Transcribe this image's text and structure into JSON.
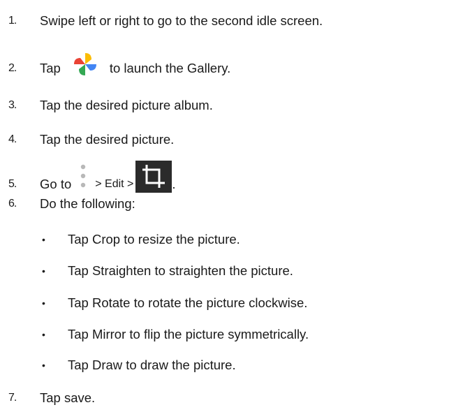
{
  "steps": [
    {
      "num": "1.",
      "text": "Swipe left or right to go to the second idle screen."
    },
    {
      "num": "2.",
      "before": "Tap",
      "icon": "gallery-pinwheel-icon",
      "after": "to launch the Gallery."
    },
    {
      "num": "3.",
      "text": "Tap the desired picture album."
    },
    {
      "num": "4.",
      "text": "Tap the desired picture."
    },
    {
      "num": "5.",
      "before": "Go to",
      "icon1": "more-options-icon",
      "middle": "> Edit >",
      "icon2": "crop-rotate-icon",
      "after": "."
    },
    {
      "num": "6.",
      "text": "Do the following:"
    },
    {
      "num": "7.",
      "text": "Tap save."
    }
  ],
  "bullets": [
    {
      "symbol": "•",
      "text": "Tap Crop to resize the picture."
    },
    {
      "symbol": "•",
      "text": "Tap Straighten to straighten the picture."
    },
    {
      "symbol": "•",
      "text": "Tap Rotate to rotate the picture clockwise."
    },
    {
      "symbol": "•",
      "text": "Tap Mirror to flip the picture symmetrically."
    },
    {
      "symbol": "•",
      "text": "Tap Draw to draw the picture."
    }
  ],
  "colors": {
    "text": "#1a1a1a",
    "crop_icon_bg": "#2b2b2b",
    "dots": "#b8b8b8",
    "pinwheel": [
      "#ea4335",
      "#fbbc05",
      "#34a853",
      "#4285f4"
    ]
  }
}
